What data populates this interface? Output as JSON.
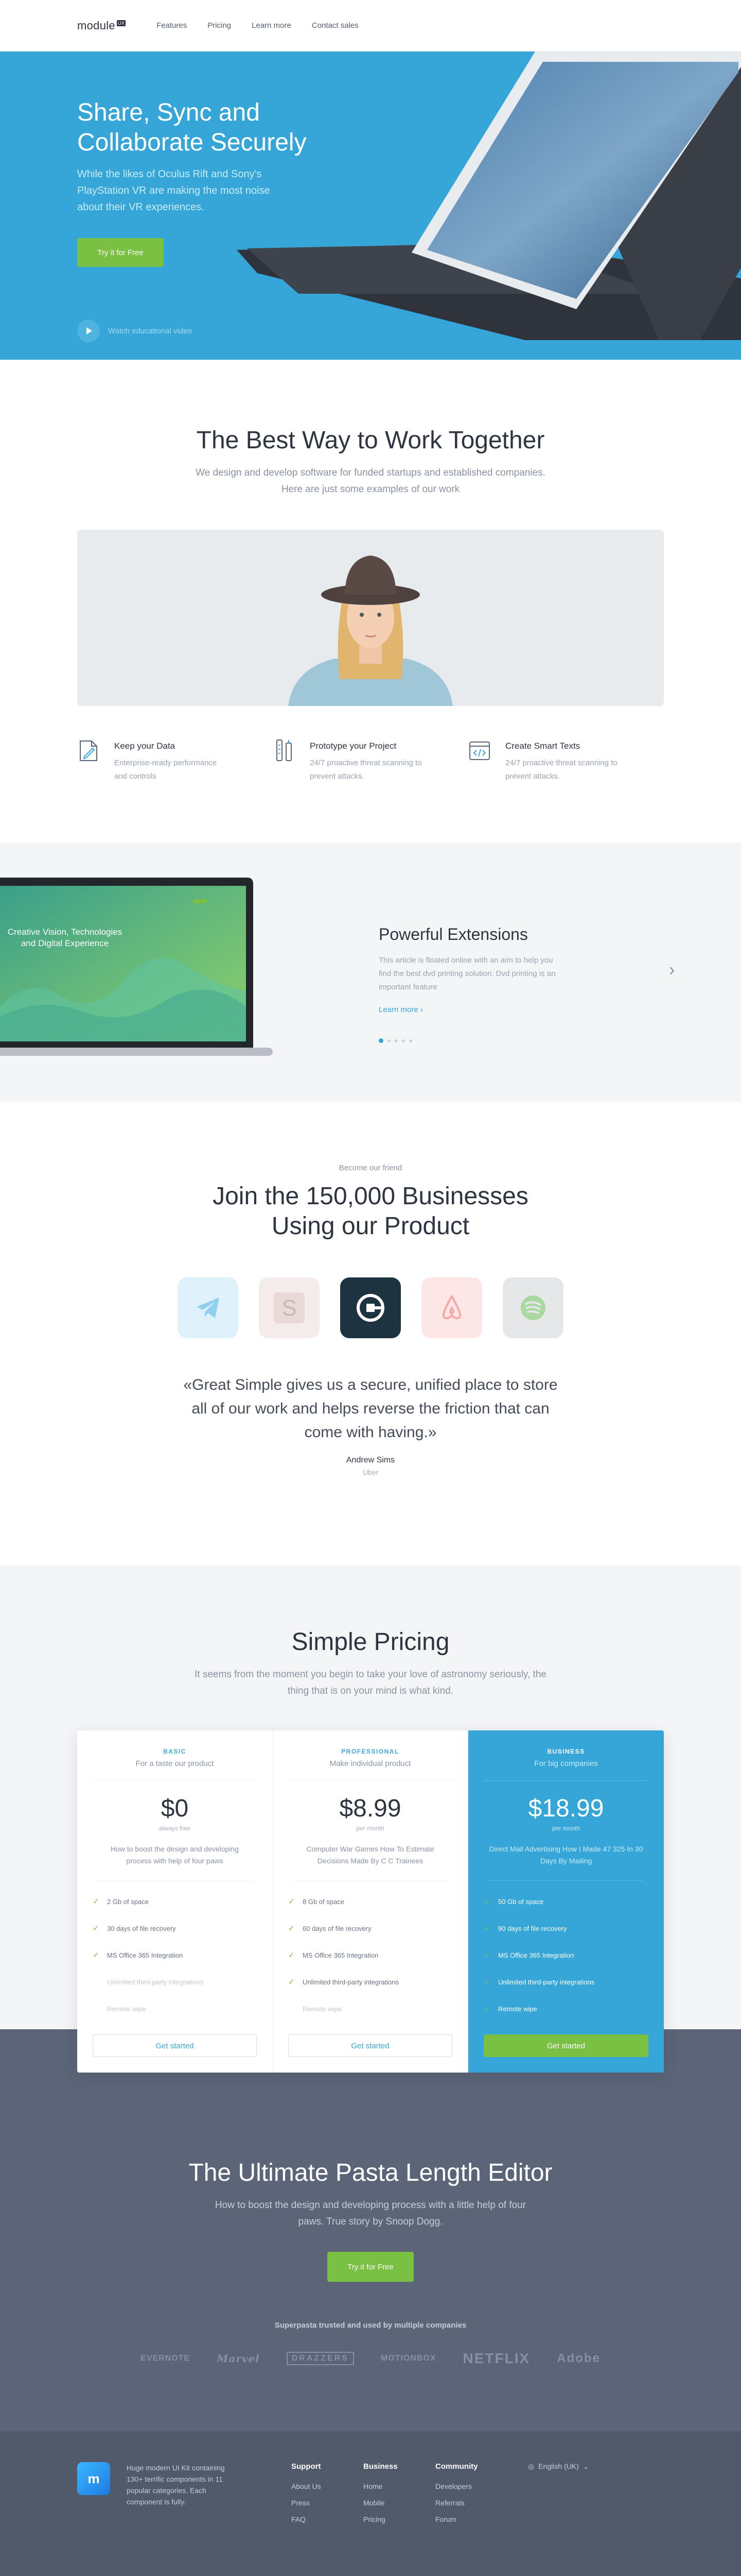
{
  "nav": {
    "logo": "module",
    "logo_badge": "UX",
    "links": [
      "Features",
      "Pricing",
      "Learn more",
      "Contact sales"
    ]
  },
  "hero": {
    "title": "Share, Sync and Collaborate Securely",
    "subtitle": "While the likes of Oculus Rift and Sony's PlayStation VR are making the most noise about their VR experiences.",
    "cta": "Try it for Free",
    "video_label": "Watch educational video"
  },
  "work": {
    "title": "The Best Way to Work Together",
    "subtitle": "We design and develop software for funded startups and established companies. Here are just some examples of our work",
    "features": [
      {
        "icon": "document-edit-icon",
        "title": "Keep your Data",
        "text": "Enterprise-ready performance and controls"
      },
      {
        "icon": "tools-icon",
        "title": "Prototype your Project",
        "text": "24/7 proactive threat scanning to prevent attacks."
      },
      {
        "icon": "code-window-icon",
        "title": "Create Smart Texts",
        "text": "24/7 proactive threat scanning to prevent attacks."
      }
    ]
  },
  "slider": {
    "screen_title": "Creative Vision, Technologies and Digital Experience",
    "title": "Powerful Extensions",
    "text": "This article is floated online with an aim to help you find the best dvd printing solution. Dvd printing is an important feature",
    "link": "Learn more",
    "arrow": "›"
  },
  "customers": {
    "kicker": "Become our friend",
    "title": "Join the 150,000 Businesses Using our Product",
    "logos": [
      "telegram-icon",
      "s-logo-icon",
      "uber-icon",
      "airbnb-icon",
      "spotify-icon"
    ],
    "quote": "«Great Simple gives us a secure, unified place to store all of our work and helps reverse the friction that can come with having.»",
    "author": "Andrew Sims",
    "company": "Uber"
  },
  "pricing": {
    "title": "Simple Pricing",
    "subtitle": "It seems from the moment you begin to take your love of astronomy seriously, the thing that is on your mind is what kind.",
    "plans": [
      {
        "name": "BASIC",
        "tagline": "For a taste our product",
        "price": "$0",
        "price_note": "always free",
        "description": "How to boost the design and developing process with help of four paws",
        "features": [
          "2 Gb of space",
          "30 days of file recovery",
          "MS Office 365 Integration",
          "Unlimited third-party integrations",
          "Remote wipe"
        ],
        "enabled": [
          true,
          true,
          true,
          false,
          false
        ],
        "button": "Get started"
      },
      {
        "name": "PROFESSIONAL",
        "tagline": "Make individual product",
        "price": "$8.99",
        "price_note": "per month",
        "description": "Computer War Games How To Estimate Decisions Made By C C Trainees",
        "features": [
          "8 Gb of space",
          "60 days of file recovery",
          "MS Office 365 Integration",
          "Unlimited third-party integrations",
          "Remote wipe"
        ],
        "enabled": [
          true,
          true,
          true,
          true,
          false
        ],
        "button": "Get started"
      },
      {
        "name": "BUSINESS",
        "tagline": "For big companies",
        "price": "$18.99",
        "price_note": "per month",
        "description": "Direct Mail Advertising How I Made 47 325 In 30 Days By Mailing",
        "features": [
          "50 Gb of space",
          "90 days of file recovery",
          "MS Office 365 Integration",
          "Unlimited third-party integrations",
          "Remote wipe"
        ],
        "enabled": [
          true,
          true,
          true,
          true,
          true
        ],
        "button": "Get started"
      }
    ]
  },
  "cta": {
    "title": "The Ultimate Pasta Length Editor",
    "subtitle": "How to boost the design and developing process with a little help of four paws. True story by Snoop Dogg.",
    "button": "Try it for Free",
    "trusted": "Superpasta trusted and used by multiple companies",
    "brands": [
      "EVERNOTE",
      "Marvel",
      "DRAZZERS",
      "MOTIONBOX",
      "NETFLIX",
      "Adobe"
    ]
  },
  "footer": {
    "logo": "m",
    "description": "Huge modern UI Kit containing 130+ terrific components in 11 popular categories. Each component is fully.",
    "columns": [
      {
        "title": "Support",
        "links": [
          "About Us",
          "Press",
          "FAQ"
        ]
      },
      {
        "title": "Business",
        "links": [
          "Home",
          "Mobile",
          "Pricing"
        ]
      },
      {
        "title": "Community",
        "links": [
          "Developers",
          "Referrals",
          "Forum"
        ]
      }
    ],
    "language": "English (UK)"
  },
  "colors": {
    "accent_blue": "#36a6d8",
    "accent_green": "#7ac143",
    "dark_slate": "#5b6577",
    "footer_slate": "#505a6b"
  }
}
